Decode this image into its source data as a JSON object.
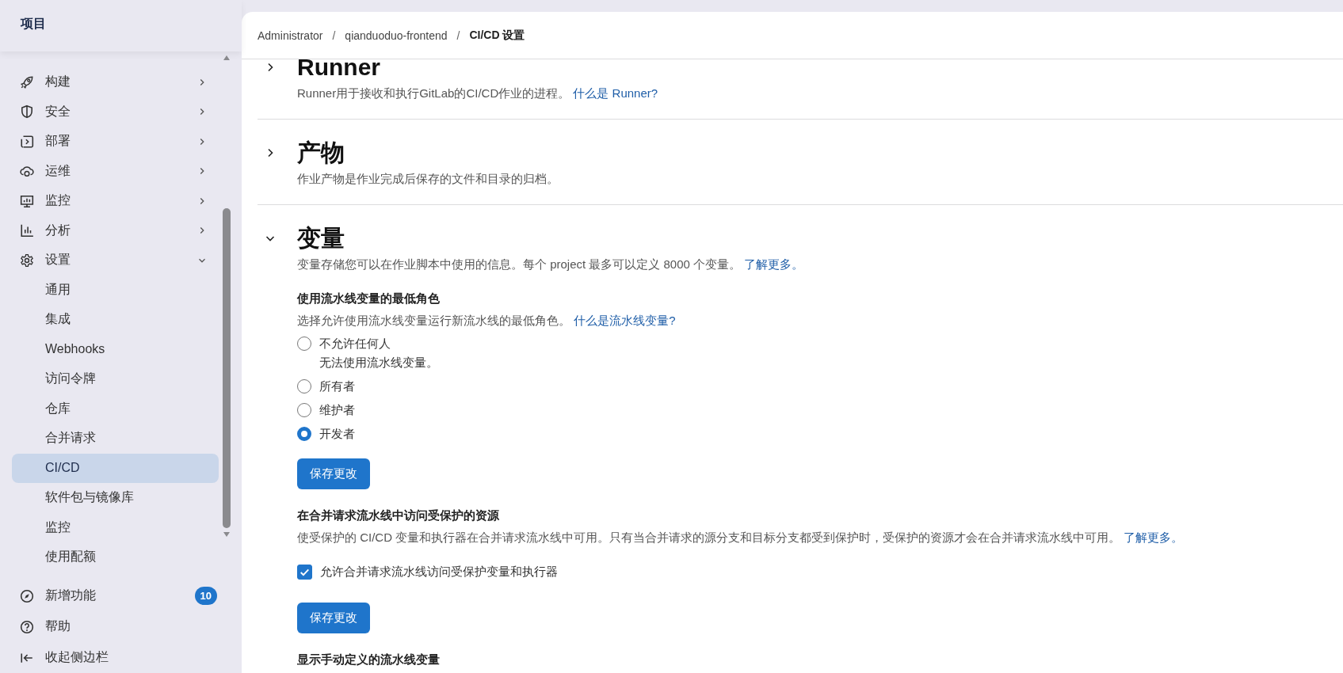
{
  "sidebar": {
    "title": "项目",
    "items": [
      {
        "label": "构建",
        "expanded": false
      },
      {
        "label": "安全",
        "expanded": false
      },
      {
        "label": "部署",
        "expanded": false
      },
      {
        "label": "运维",
        "expanded": false
      },
      {
        "label": "监控",
        "expanded": false
      },
      {
        "label": "分析",
        "expanded": false
      },
      {
        "label": "设置",
        "expanded": true,
        "children": [
          {
            "label": "通用",
            "selected": false
          },
          {
            "label": "集成",
            "selected": false
          },
          {
            "label": "Webhooks",
            "selected": false
          },
          {
            "label": "访问令牌",
            "selected": false
          },
          {
            "label": "仓库",
            "selected": false
          },
          {
            "label": "合并请求",
            "selected": false
          },
          {
            "label": "CI/CD",
            "selected": true
          },
          {
            "label": "软件包与镜像库",
            "selected": false
          },
          {
            "label": "监控",
            "selected": false
          },
          {
            "label": "使用配额",
            "selected": false
          }
        ]
      }
    ],
    "footer": [
      {
        "label": "新增功能",
        "badge": "10"
      },
      {
        "label": "帮助"
      },
      {
        "label": "收起侧边栏"
      }
    ]
  },
  "breadcrumb": [
    {
      "kind": "link",
      "text": "Administrator"
    },
    {
      "kind": "separator",
      "text": "/"
    },
    {
      "kind": "link",
      "text": "qianduoduo-frontend"
    },
    {
      "kind": "separator",
      "text": "/"
    },
    {
      "kind": "current",
      "text": "CI/CD 设置"
    }
  ],
  "sections": [
    {
      "title": "Runner",
      "expanded": false,
      "description": "Runner用于接收和执行GitLab的CI/CD作业的进程。",
      "link": "什么是 Runner?"
    },
    {
      "title": "产物",
      "expanded": false,
      "description": "作业产物是作业完成后保存的文件和目录的归档。"
    },
    {
      "title": "变量",
      "expanded": true,
      "description": "变量存储您可以在作业脚本中使用的信息。每个 project 最多可以定义 8000 个变量。",
      "link": "了解更多。",
      "groups": [
        {
          "kind": "radio",
          "heading": "使用流水线变量的最低角色",
          "description": "选择允许使用流水线变量运行新流水线的最低角色。",
          "link": "什么是流水线变量?",
          "options": [
            {
              "label": "不允许任何人",
              "hint": "无法使用流水线变量。",
              "selected": false
            },
            {
              "label": "所有者",
              "selected": false
            },
            {
              "label": "维护者",
              "selected": false
            },
            {
              "label": "开发者",
              "selected": true
            }
          ],
          "button": "保存更改"
        },
        {
          "kind": "checkbox",
          "heading": "在合并请求流水线中访问受保护的资源",
          "description": "使受保护的 CI/CD 变量和执行器在合并请求流水线中可用。只有当合并请求的源分支和目标分支都受到保护时，受保护的资源才会在合并请求流水线中可用。",
          "link": "了解更多。",
          "options": [
            {
              "label": "允许合并请求流水线访问受保护变量和执行器",
              "checked": true
            }
          ],
          "button": "保存更改"
        },
        {
          "kind": "heading",
          "heading": "显示手动定义的流水线变量"
        }
      ]
    }
  ]
}
